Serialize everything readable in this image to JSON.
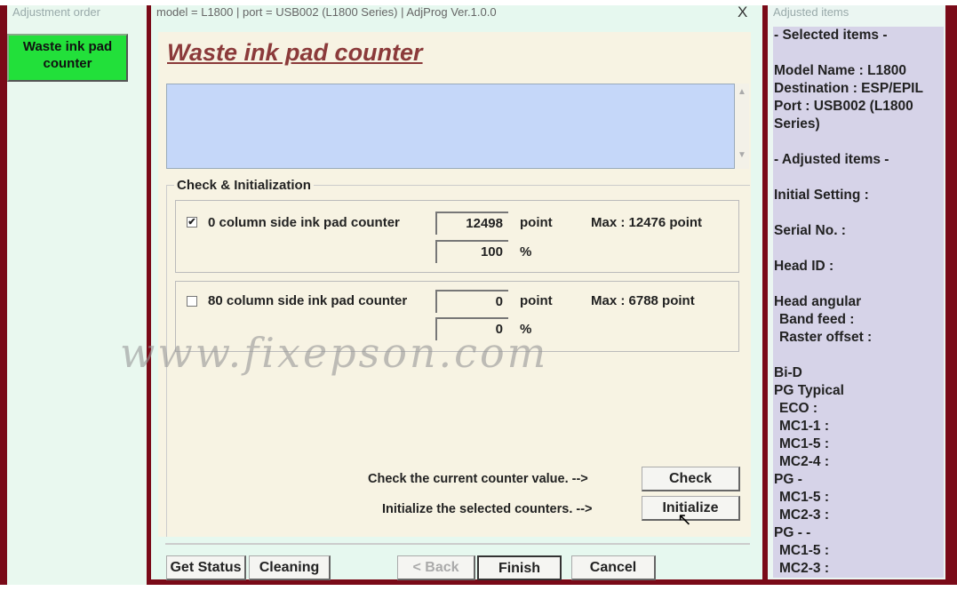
{
  "window": {
    "left_header": "Adjustment order",
    "title": "model = L1800 | port = USB002 (L1800 Series) | AdjProg Ver.1.0.0",
    "close": "X",
    "right_header": "Adjusted items"
  },
  "sidebar": {
    "active_item": "Waste ink pad counter",
    "active_color": "#22e03a"
  },
  "page": {
    "title": "Waste ink pad counter",
    "group_label": "Check & Initialization"
  },
  "counters": [
    {
      "label": "0 column side ink pad counter",
      "checked": true,
      "point": "12498",
      "percent": "100",
      "point_unit": "point",
      "percent_unit": "%",
      "max": "Max : 12476 point"
    },
    {
      "label": "80 column side ink pad counter",
      "checked": false,
      "point": "0",
      "percent": "0",
      "point_unit": "point",
      "percent_unit": "%",
      "max": "Max : 6788 point"
    }
  ],
  "actions": {
    "check_text": "Check the current counter value. -->",
    "check_button": "Check",
    "init_text": "Initialize the selected counters. -->",
    "init_button": "Initialize"
  },
  "footer": {
    "get_status": "Get Status",
    "cleaning": "Cleaning",
    "back": "< Back",
    "finish": "Finish",
    "cancel": "Cancel"
  },
  "watermark": "www.fixepson.com",
  "right_panel": [
    "- Selected items -",
    "Model Name : L1800",
    "Destination : ESP/EPIL",
    "Port : USB002 (L1800",
    "Series)",
    "- Adjusted items -",
    "Initial Setting :",
    "Serial No. :",
    "Head ID :",
    "Head angular",
    "Band feed :",
    "Raster offset :",
    "Bi-D",
    "PG Typical",
    "ECO   :",
    "MC1-1 :",
    "MC1-5 :",
    "MC2-4 :",
    "PG -",
    "MC1-5 :",
    "MC2-3 :",
    "PG - -",
    "MC1-5 :",
    "MC2-3 :"
  ],
  "colors": {
    "frame": "#7a0a18",
    "title": "#8b3a3a",
    "right_panel": "#d6d3e8"
  }
}
